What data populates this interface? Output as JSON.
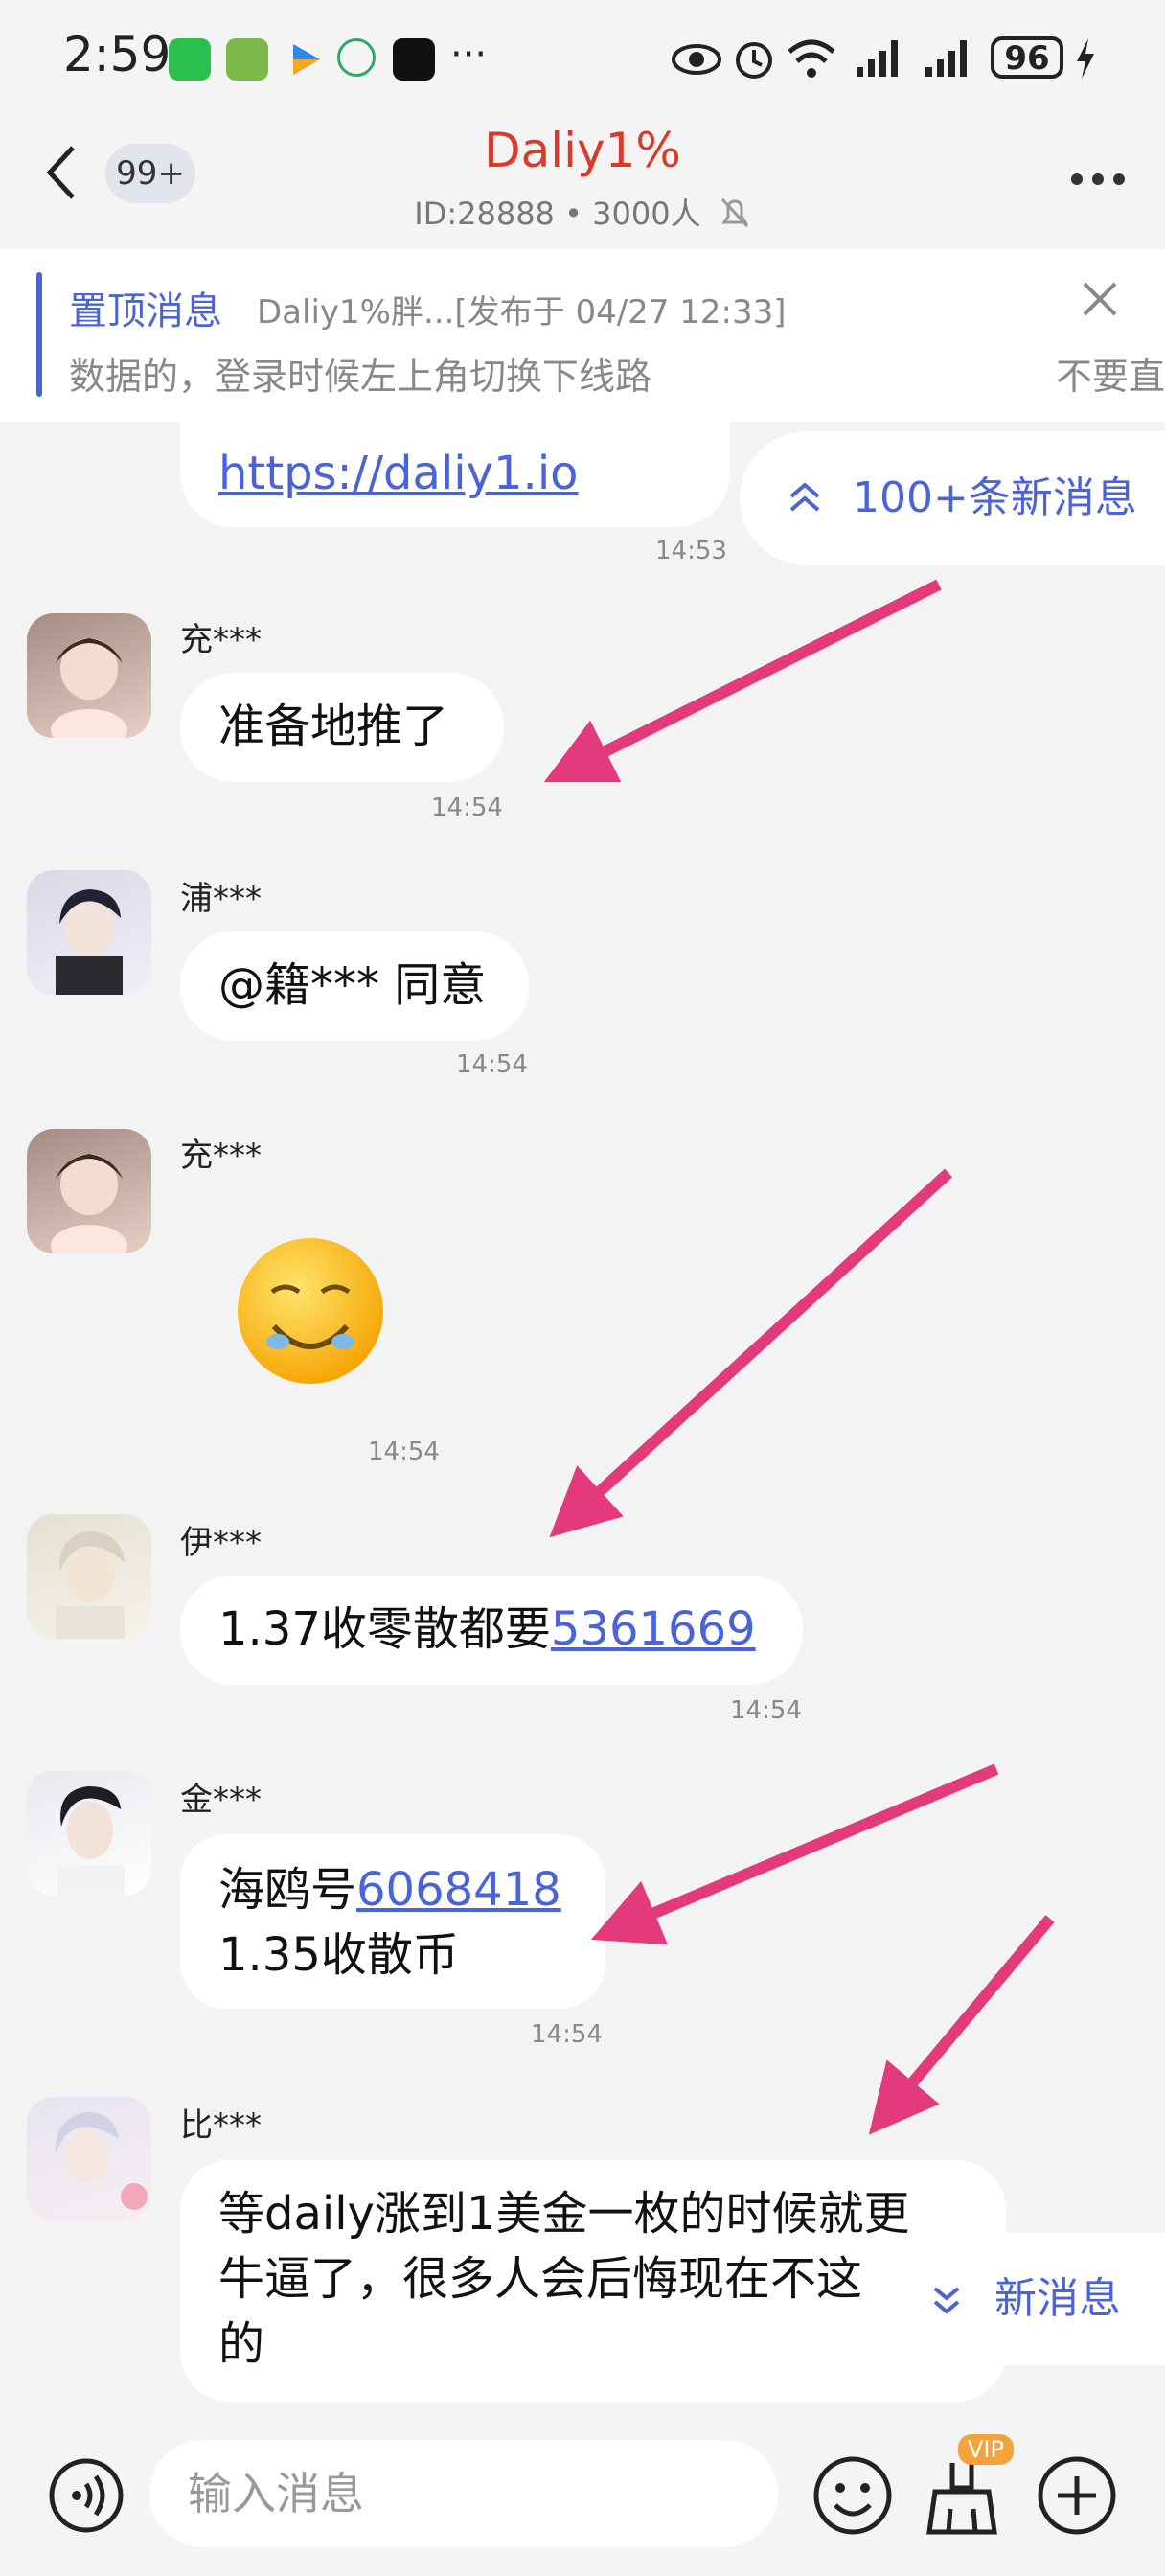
{
  "status_bar": {
    "time": "2:59",
    "more_icon": "···",
    "battery": "96"
  },
  "header": {
    "badge": "99+",
    "title": "Daliy1%",
    "subtitle": "ID:28888  •  3000人",
    "title_color": "#d93b2b"
  },
  "pinned": {
    "label": "置顶消息",
    "meta": "Daliy1%胖...[发布于 04/27 12:33]",
    "text": "数据的，登录时候左上角切换下线路",
    "right_text": "不要直"
  },
  "new_messages_top": "100+条新消息",
  "new_messages_bottom": "新消息",
  "messages": [
    {
      "link": "https://daliy1.io",
      "time": "14:53"
    },
    {
      "user": "充***",
      "text": "准备地推了",
      "time": "14:54"
    },
    {
      "user": "浦***",
      "text": "@籍*** 同意",
      "time": "14:54"
    },
    {
      "user": "充***",
      "time": "14:54"
    },
    {
      "user": "伊***",
      "text": "1.37收零散都要",
      "link": "5361669",
      "time": "14:54"
    },
    {
      "user": "金***",
      "text": "海鸥号",
      "link": "6068418",
      "line2": "1.35收散币",
      "time": "14:54"
    },
    {
      "user": "比***",
      "lines": [
        "等daily涨到1美金一枚的时候就更",
        "牛逼了，很多人会后悔现在不这",
        "的"
      ]
    }
  ],
  "input": {
    "placeholder": "输入消息",
    "vip": "VIP"
  },
  "colors": {
    "accent": "#4a63d8",
    "arrow": "#e23a7a"
  }
}
